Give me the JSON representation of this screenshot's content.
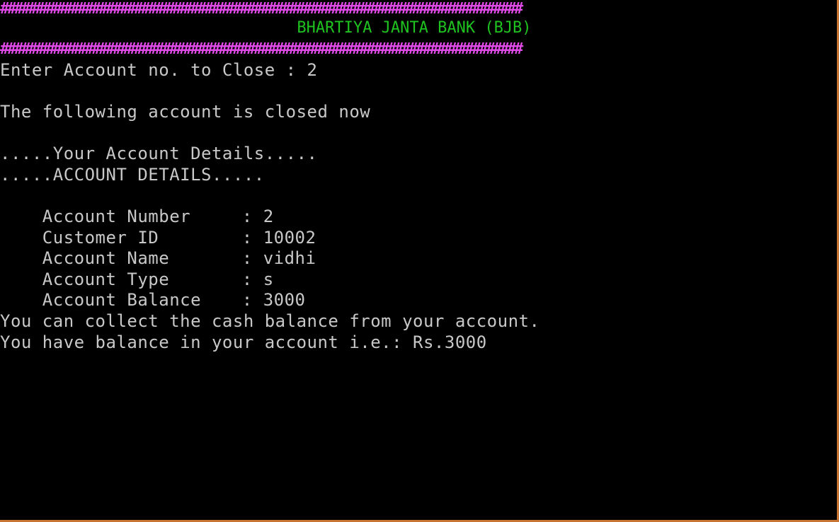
{
  "colors": {
    "background": "#000000",
    "text": "#c8c8c8",
    "border": "#e04be8",
    "title": "#1fc31f",
    "frame": "#c87533"
  },
  "header": {
    "border_top": "##########################################################################",
    "title": "BHARTIYA JANTA BANK (BJB)",
    "border_bottom": "##########################################################################"
  },
  "prompt": {
    "text": "Enter Account no. to Close : 2"
  },
  "status": {
    "closed_message": "The following account is closed now"
  },
  "details": {
    "heading1": ".....Your Account Details.....",
    "heading2": ".....ACCOUNT DETAILS.....",
    "rows": [
      {
        "label": "Account Number",
        "value": ": 2"
      },
      {
        "label": "Customer ID",
        "value": ": 10002"
      },
      {
        "label": "Account Name",
        "value": ": vidhi"
      },
      {
        "label": "Account Type",
        "value": ": s"
      },
      {
        "label": "Account Balance",
        "value": ": 3000"
      }
    ]
  },
  "footer": {
    "collect_message": "You can collect the cash balance from your account.",
    "balance_message": "You have balance in your account i.e.: Rs.3000"
  }
}
